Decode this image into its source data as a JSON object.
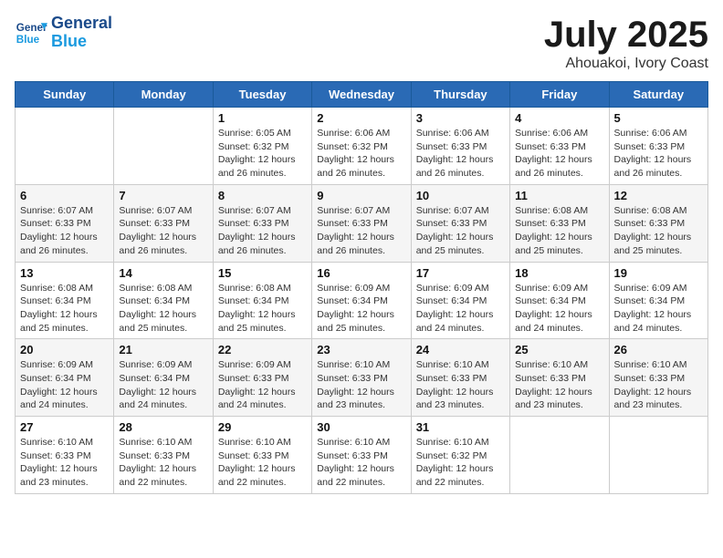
{
  "logo": {
    "line1": "General",
    "line2": "Blue"
  },
  "title": "July 2025",
  "subtitle": "Ahouakoi, Ivory Coast",
  "days_header": [
    "Sunday",
    "Monday",
    "Tuesday",
    "Wednesday",
    "Thursday",
    "Friday",
    "Saturday"
  ],
  "weeks": [
    [
      {
        "day": "",
        "detail": ""
      },
      {
        "day": "",
        "detail": ""
      },
      {
        "day": "1",
        "detail": "Sunrise: 6:05 AM\nSunset: 6:32 PM\nDaylight: 12 hours and 26 minutes."
      },
      {
        "day": "2",
        "detail": "Sunrise: 6:06 AM\nSunset: 6:32 PM\nDaylight: 12 hours and 26 minutes."
      },
      {
        "day": "3",
        "detail": "Sunrise: 6:06 AM\nSunset: 6:33 PM\nDaylight: 12 hours and 26 minutes."
      },
      {
        "day": "4",
        "detail": "Sunrise: 6:06 AM\nSunset: 6:33 PM\nDaylight: 12 hours and 26 minutes."
      },
      {
        "day": "5",
        "detail": "Sunrise: 6:06 AM\nSunset: 6:33 PM\nDaylight: 12 hours and 26 minutes."
      }
    ],
    [
      {
        "day": "6",
        "detail": "Sunrise: 6:07 AM\nSunset: 6:33 PM\nDaylight: 12 hours and 26 minutes."
      },
      {
        "day": "7",
        "detail": "Sunrise: 6:07 AM\nSunset: 6:33 PM\nDaylight: 12 hours and 26 minutes."
      },
      {
        "day": "8",
        "detail": "Sunrise: 6:07 AM\nSunset: 6:33 PM\nDaylight: 12 hours and 26 minutes."
      },
      {
        "day": "9",
        "detail": "Sunrise: 6:07 AM\nSunset: 6:33 PM\nDaylight: 12 hours and 26 minutes."
      },
      {
        "day": "10",
        "detail": "Sunrise: 6:07 AM\nSunset: 6:33 PM\nDaylight: 12 hours and 25 minutes."
      },
      {
        "day": "11",
        "detail": "Sunrise: 6:08 AM\nSunset: 6:33 PM\nDaylight: 12 hours and 25 minutes."
      },
      {
        "day": "12",
        "detail": "Sunrise: 6:08 AM\nSunset: 6:33 PM\nDaylight: 12 hours and 25 minutes."
      }
    ],
    [
      {
        "day": "13",
        "detail": "Sunrise: 6:08 AM\nSunset: 6:34 PM\nDaylight: 12 hours and 25 minutes."
      },
      {
        "day": "14",
        "detail": "Sunrise: 6:08 AM\nSunset: 6:34 PM\nDaylight: 12 hours and 25 minutes."
      },
      {
        "day": "15",
        "detail": "Sunrise: 6:08 AM\nSunset: 6:34 PM\nDaylight: 12 hours and 25 minutes."
      },
      {
        "day": "16",
        "detail": "Sunrise: 6:09 AM\nSunset: 6:34 PM\nDaylight: 12 hours and 25 minutes."
      },
      {
        "day": "17",
        "detail": "Sunrise: 6:09 AM\nSunset: 6:34 PM\nDaylight: 12 hours and 24 minutes."
      },
      {
        "day": "18",
        "detail": "Sunrise: 6:09 AM\nSunset: 6:34 PM\nDaylight: 12 hours and 24 minutes."
      },
      {
        "day": "19",
        "detail": "Sunrise: 6:09 AM\nSunset: 6:34 PM\nDaylight: 12 hours and 24 minutes."
      }
    ],
    [
      {
        "day": "20",
        "detail": "Sunrise: 6:09 AM\nSunset: 6:34 PM\nDaylight: 12 hours and 24 minutes."
      },
      {
        "day": "21",
        "detail": "Sunrise: 6:09 AM\nSunset: 6:34 PM\nDaylight: 12 hours and 24 minutes."
      },
      {
        "day": "22",
        "detail": "Sunrise: 6:09 AM\nSunset: 6:33 PM\nDaylight: 12 hours and 24 minutes."
      },
      {
        "day": "23",
        "detail": "Sunrise: 6:10 AM\nSunset: 6:33 PM\nDaylight: 12 hours and 23 minutes."
      },
      {
        "day": "24",
        "detail": "Sunrise: 6:10 AM\nSunset: 6:33 PM\nDaylight: 12 hours and 23 minutes."
      },
      {
        "day": "25",
        "detail": "Sunrise: 6:10 AM\nSunset: 6:33 PM\nDaylight: 12 hours and 23 minutes."
      },
      {
        "day": "26",
        "detail": "Sunrise: 6:10 AM\nSunset: 6:33 PM\nDaylight: 12 hours and 23 minutes."
      }
    ],
    [
      {
        "day": "27",
        "detail": "Sunrise: 6:10 AM\nSunset: 6:33 PM\nDaylight: 12 hours and 23 minutes."
      },
      {
        "day": "28",
        "detail": "Sunrise: 6:10 AM\nSunset: 6:33 PM\nDaylight: 12 hours and 22 minutes."
      },
      {
        "day": "29",
        "detail": "Sunrise: 6:10 AM\nSunset: 6:33 PM\nDaylight: 12 hours and 22 minutes."
      },
      {
        "day": "30",
        "detail": "Sunrise: 6:10 AM\nSunset: 6:33 PM\nDaylight: 12 hours and 22 minutes."
      },
      {
        "day": "31",
        "detail": "Sunrise: 6:10 AM\nSunset: 6:32 PM\nDaylight: 12 hours and 22 minutes."
      },
      {
        "day": "",
        "detail": ""
      },
      {
        "day": "",
        "detail": ""
      }
    ]
  ]
}
